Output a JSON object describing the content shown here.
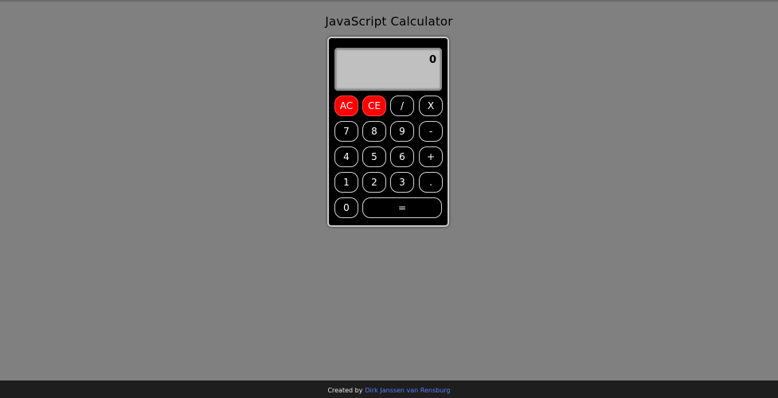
{
  "page": {
    "title": "JavaScript Calculator"
  },
  "display": {
    "value": "0"
  },
  "keys": {
    "ac": "AC",
    "ce": "CE",
    "divide": "/",
    "multiply": "X",
    "seven": "7",
    "eight": "8",
    "nine": "9",
    "minus": "-",
    "four": "4",
    "five": "5",
    "six": "6",
    "plus": "+",
    "one": "1",
    "two": "2",
    "three": "3",
    "decimal": ".",
    "zero": "0",
    "equals": "="
  },
  "footer": {
    "created_by": "Created by",
    "author": "Dirk Janssen van Rensburg"
  },
  "colors": {
    "clear_key": "#ff0000",
    "background": "#808080",
    "calculator_body": "#000000",
    "display_bg": "#c0c0c0",
    "footer_bg": "#1e1e1e",
    "link": "#5b7cff"
  }
}
